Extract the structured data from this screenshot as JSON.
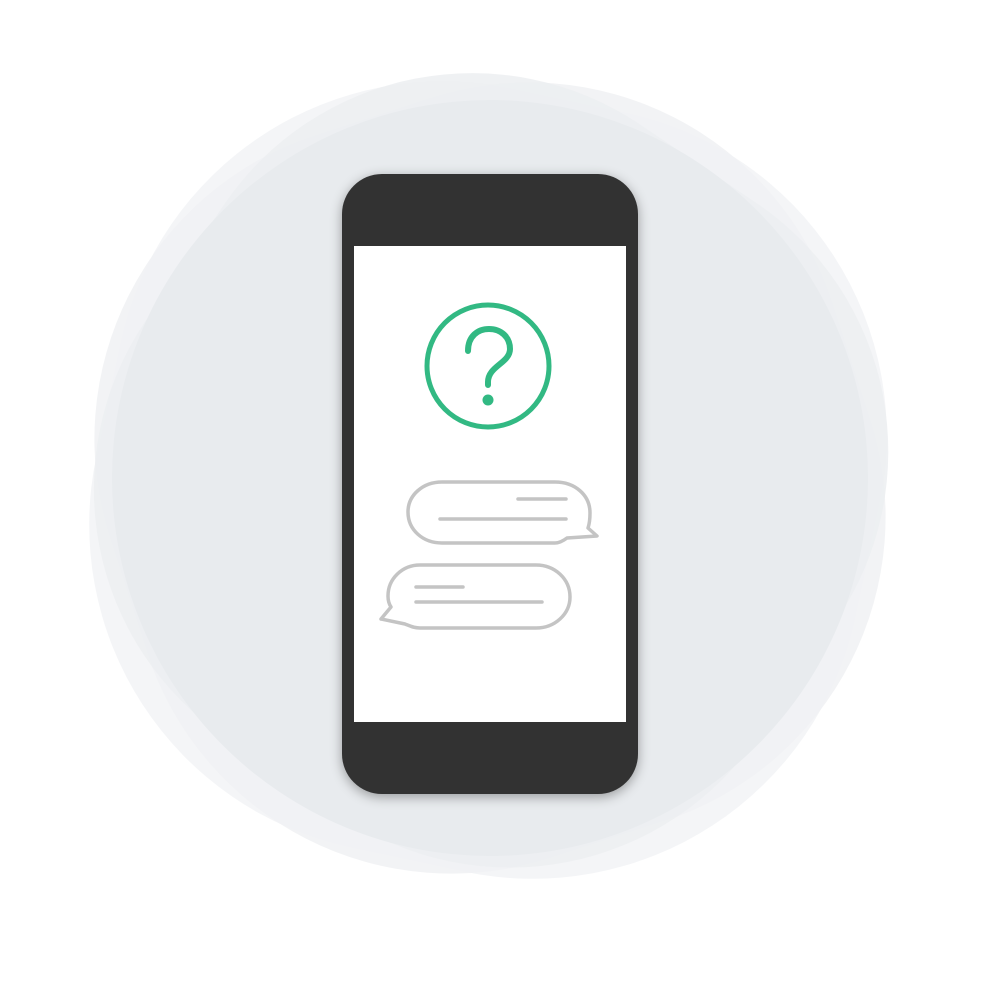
{
  "illustration": {
    "subject": "phone-help-chat",
    "icons": {
      "help": "question-mark-icon",
      "incoming": "chat-bubble-icon",
      "outgoing": "chat-bubble-icon"
    },
    "colors": {
      "page_background": "#ffffff",
      "backdrop": "#e8ebee",
      "backdrop_light": "#f3f4f6",
      "phone_body": "#333333",
      "phone_screen": "#ffffff",
      "accent_green": "#32b983",
      "bubble_outline": "#c4c4c4"
    }
  }
}
